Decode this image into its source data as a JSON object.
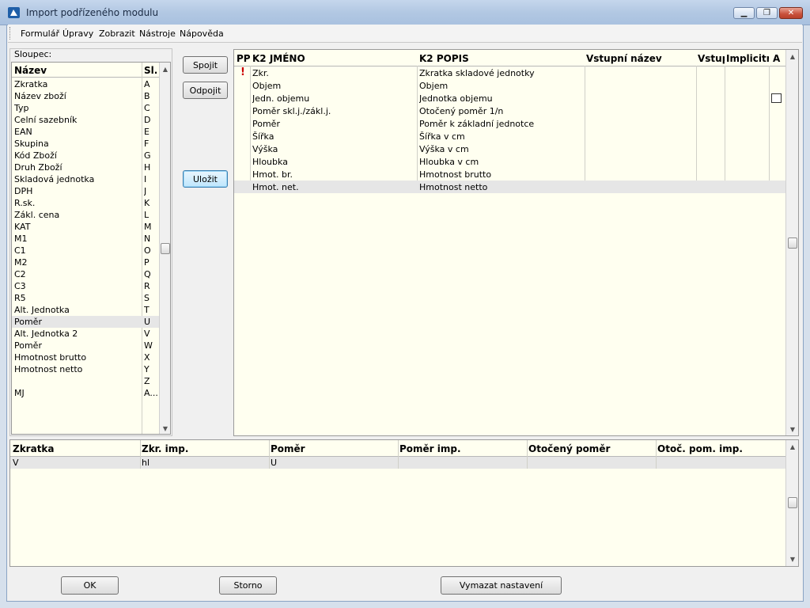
{
  "window": {
    "title": "Import podřízeného modulu"
  },
  "menu": [
    "Formulář",
    "Úpravy",
    "Zobrazit",
    "Nástroje",
    "Nápověda"
  ],
  "left_panel": {
    "group_label": "Sloupec:",
    "headers": {
      "name": "Název",
      "col": "Sl."
    },
    "rows": [
      {
        "name": "Zkratka",
        "col": "A"
      },
      {
        "name": "Název zboží",
        "col": "B"
      },
      {
        "name": "Typ",
        "col": "C"
      },
      {
        "name": "Celní sazebník",
        "col": "D"
      },
      {
        "name": "EAN",
        "col": "E"
      },
      {
        "name": "Skupina",
        "col": "F"
      },
      {
        "name": "Kód Zboží",
        "col": "G"
      },
      {
        "name": "Druh Zboží",
        "col": "H"
      },
      {
        "name": "Skladová jednotka",
        "col": "I"
      },
      {
        "name": "DPH",
        "col": "J"
      },
      {
        "name": "R.sk.",
        "col": "K"
      },
      {
        "name": "Zákl. cena",
        "col": "L"
      },
      {
        "name": "KAT",
        "col": "M"
      },
      {
        "name": "M1",
        "col": "N"
      },
      {
        "name": "C1",
        "col": "O"
      },
      {
        "name": "M2",
        "col": "P"
      },
      {
        "name": "C2",
        "col": "Q"
      },
      {
        "name": "C3",
        "col": "R"
      },
      {
        "name": "R5",
        "col": "S"
      },
      {
        "name": "Alt. Jednotka",
        "col": "T"
      },
      {
        "name": "Poměr",
        "col": "U"
      },
      {
        "name": "Alt. Jednotka 2",
        "col": "V"
      },
      {
        "name": "Poměr",
        "col": "W"
      },
      {
        "name": "Hmotnost brutto",
        "col": "X"
      },
      {
        "name": "Hmotnost netto",
        "col": "Y"
      },
      {
        "name": "",
        "col": "Z"
      },
      {
        "name": "MJ",
        "col": "A..."
      }
    ],
    "selected_index": 20
  },
  "buttons": {
    "join": "Spojit",
    "unjoin": "Odpojit",
    "save": "Uložit"
  },
  "right_grid": {
    "headers": [
      "PP",
      "K2 JMÉNO",
      "K2 POPIS",
      "Vstupní název",
      "Vstup",
      "Implicitn",
      "A"
    ],
    "rows": [
      {
        "pp": "!",
        "name": "Zkr.",
        "desc": "Zkratka skladové jednotky"
      },
      {
        "pp": "",
        "name": "Objem",
        "desc": "Objem"
      },
      {
        "pp": "",
        "name": "Jedn. objemu",
        "desc": "Jednotka objemu"
      },
      {
        "pp": "",
        "name": "Poměr skl.j./zákl.j.",
        "desc": "Otočený poměr 1/n"
      },
      {
        "pp": "",
        "name": "Poměr",
        "desc": "Poměr k základní jednotce"
      },
      {
        "pp": "",
        "name": "Šířka",
        "desc": "Šířka v cm"
      },
      {
        "pp": "",
        "name": "Výška",
        "desc": "Výška v cm"
      },
      {
        "pp": "",
        "name": "Hloubka",
        "desc": "Hloubka v cm"
      },
      {
        "pp": "",
        "name": "Hmot. br.",
        "desc": "Hmotnost brutto"
      },
      {
        "pp": "",
        "name": "Hmot. net.",
        "desc": "Hmotnost netto"
      }
    ],
    "selected_index": 9,
    "checkbox_row": 2
  },
  "bottom_grid": {
    "headers": [
      "Zkratka",
      "Zkr. imp.",
      "Poměr",
      "Poměr imp.",
      "Otočený poměr",
      "Otoč. pom. imp."
    ],
    "row": [
      "V",
      "hl",
      "U",
      "",
      "",
      ""
    ]
  },
  "footer": {
    "ok": "OK",
    "cancel": "Storno",
    "clear": "Vymazat nastavení"
  },
  "colors": {
    "grid_bg": "#fffff0",
    "accent": "#3c7fb1",
    "warning": "#cc0000"
  }
}
